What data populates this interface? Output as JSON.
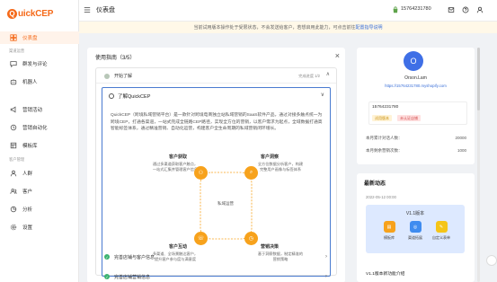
{
  "brand": {
    "logo_q": "Q",
    "logo_text": "uickCEP",
    "accent": "#f56a1a"
  },
  "sidebar": {
    "items": [
      {
        "label": "仪表盘",
        "icon": "dashboard-icon",
        "active": true
      },
      {
        "label": "群发与评论",
        "icon": "message-icon"
      },
      {
        "label": "机器人",
        "icon": "robot-icon"
      },
      {
        "label": "营销活动",
        "icon": "campaign-icon"
      },
      {
        "label": "营销自动化",
        "icon": "automation-icon"
      },
      {
        "label": "模板库",
        "icon": "template-icon"
      },
      {
        "label": "人群",
        "icon": "people-icon"
      },
      {
        "label": "客户",
        "icon": "customer-icon"
      },
      {
        "label": "分析",
        "icon": "analysis-icon"
      },
      {
        "label": "设置",
        "icon": "settings-icon"
      }
    ],
    "groups": [
      "渠道运营",
      "客户管理"
    ]
  },
  "header": {
    "title": "仪表盘",
    "phone": "15764231780"
  },
  "banner": {
    "text": "当前试用版本操作处于受限状态，不会发送给客户，若想启用此能力，可点击前往",
    "link": "配置指导说明"
  },
  "guide": {
    "title": "使用指南（3/5）",
    "step_label": "开始了解",
    "step_count": "完成进度 1/2",
    "topic_title": "了解QuickCEP",
    "topic_desc": "QuickCEP（跨境私域营销平台）是一款针对跨境电商独立站私域营销的SaaS软件产品，通过对接多触点统一为跨境CEP，打通各渠道，一站式完成全链路CEP路径，实现全方位的营销，以客户需求为起点，全域数据打通高智能标签体系，通过精准营销、自动化运营，构建客户全生命周期的私域营销闭环增长。",
    "diagram": {
      "top_left_title": "客户获取",
      "top_left_text": "通过多渠道获取客户触点，一站式汇集并管理客户信息",
      "top_right_title": "客户洞察",
      "top_right_text": "全方位数据分析客户，构建完整用户画像与标签体系",
      "bottom_left_title": "客户互动",
      "bottom_left_text": "多渠道、全场景触达客户，提升客户参与度与满意度",
      "bottom_right_title": "营销决策",
      "bottom_right_text": "基于洞察数据，制定精准的营销策略",
      "center": "私域运营"
    },
    "rows": [
      {
        "label": "完善店铺与客户信息"
      },
      {
        "label": "完善店铺营销信息"
      }
    ]
  },
  "profile": {
    "avatar_initial": "O",
    "name": "Orson.Lam",
    "link": "https://15764231780.myshopify.com",
    "phone": "15764231780",
    "tag1": "试用版本",
    "tag2": "未认证店铺",
    "stats": [
      {
        "label": "本月累计对话人数：",
        "value": "20000"
      },
      {
        "label": "本月剩余营销次数：",
        "value": "1000"
      }
    ]
  },
  "news": {
    "title": "最新动态",
    "date": "2022-05-12 00:00",
    "version": "V1.1版本",
    "features": [
      {
        "label": "模板库",
        "color": "#f7a21c"
      },
      {
        "label": "渠道拓展",
        "color": "#3f8cf0"
      },
      {
        "label": "自定义表单",
        "color": "#f5c518"
      }
    ],
    "footer": "V1.1版本新功能介绍"
  }
}
